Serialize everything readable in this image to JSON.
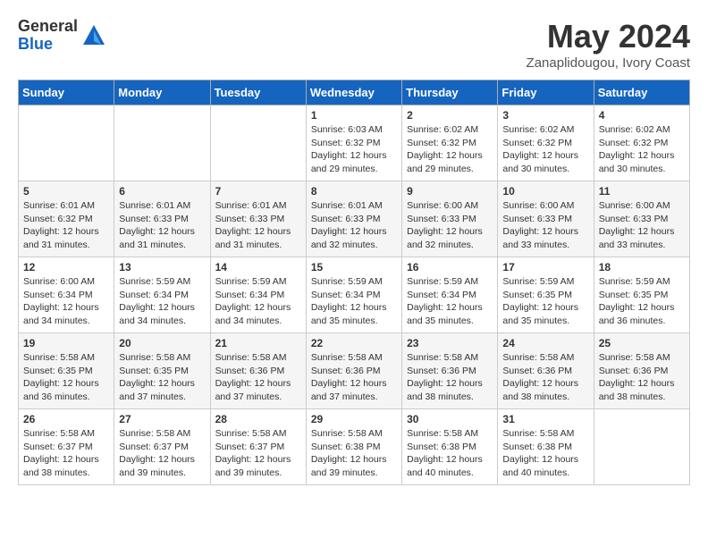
{
  "logo": {
    "general": "General",
    "blue": "Blue"
  },
  "title": "May 2024",
  "location": "Zanaplidougou, Ivory Coast",
  "weekdays": [
    "Sunday",
    "Monday",
    "Tuesday",
    "Wednesday",
    "Thursday",
    "Friday",
    "Saturday"
  ],
  "weeks": [
    [
      {
        "day": "",
        "sunrise": "",
        "sunset": "",
        "daylight": ""
      },
      {
        "day": "",
        "sunrise": "",
        "sunset": "",
        "daylight": ""
      },
      {
        "day": "",
        "sunrise": "",
        "sunset": "",
        "daylight": ""
      },
      {
        "day": "1",
        "sunrise": "Sunrise: 6:03 AM",
        "sunset": "Sunset: 6:32 PM",
        "daylight": "Daylight: 12 hours and 29 minutes."
      },
      {
        "day": "2",
        "sunrise": "Sunrise: 6:02 AM",
        "sunset": "Sunset: 6:32 PM",
        "daylight": "Daylight: 12 hours and 29 minutes."
      },
      {
        "day": "3",
        "sunrise": "Sunrise: 6:02 AM",
        "sunset": "Sunset: 6:32 PM",
        "daylight": "Daylight: 12 hours and 30 minutes."
      },
      {
        "day": "4",
        "sunrise": "Sunrise: 6:02 AM",
        "sunset": "Sunset: 6:32 PM",
        "daylight": "Daylight: 12 hours and 30 minutes."
      }
    ],
    [
      {
        "day": "5",
        "sunrise": "Sunrise: 6:01 AM",
        "sunset": "Sunset: 6:32 PM",
        "daylight": "Daylight: 12 hours and 31 minutes."
      },
      {
        "day": "6",
        "sunrise": "Sunrise: 6:01 AM",
        "sunset": "Sunset: 6:33 PM",
        "daylight": "Daylight: 12 hours and 31 minutes."
      },
      {
        "day": "7",
        "sunrise": "Sunrise: 6:01 AM",
        "sunset": "Sunset: 6:33 PM",
        "daylight": "Daylight: 12 hours and 31 minutes."
      },
      {
        "day": "8",
        "sunrise": "Sunrise: 6:01 AM",
        "sunset": "Sunset: 6:33 PM",
        "daylight": "Daylight: 12 hours and 32 minutes."
      },
      {
        "day": "9",
        "sunrise": "Sunrise: 6:00 AM",
        "sunset": "Sunset: 6:33 PM",
        "daylight": "Daylight: 12 hours and 32 minutes."
      },
      {
        "day": "10",
        "sunrise": "Sunrise: 6:00 AM",
        "sunset": "Sunset: 6:33 PM",
        "daylight": "Daylight: 12 hours and 33 minutes."
      },
      {
        "day": "11",
        "sunrise": "Sunrise: 6:00 AM",
        "sunset": "Sunset: 6:33 PM",
        "daylight": "Daylight: 12 hours and 33 minutes."
      }
    ],
    [
      {
        "day": "12",
        "sunrise": "Sunrise: 6:00 AM",
        "sunset": "Sunset: 6:34 PM",
        "daylight": "Daylight: 12 hours and 34 minutes."
      },
      {
        "day": "13",
        "sunrise": "Sunrise: 5:59 AM",
        "sunset": "Sunset: 6:34 PM",
        "daylight": "Daylight: 12 hours and 34 minutes."
      },
      {
        "day": "14",
        "sunrise": "Sunrise: 5:59 AM",
        "sunset": "Sunset: 6:34 PM",
        "daylight": "Daylight: 12 hours and 34 minutes."
      },
      {
        "day": "15",
        "sunrise": "Sunrise: 5:59 AM",
        "sunset": "Sunset: 6:34 PM",
        "daylight": "Daylight: 12 hours and 35 minutes."
      },
      {
        "day": "16",
        "sunrise": "Sunrise: 5:59 AM",
        "sunset": "Sunset: 6:34 PM",
        "daylight": "Daylight: 12 hours and 35 minutes."
      },
      {
        "day": "17",
        "sunrise": "Sunrise: 5:59 AM",
        "sunset": "Sunset: 6:35 PM",
        "daylight": "Daylight: 12 hours and 35 minutes."
      },
      {
        "day": "18",
        "sunrise": "Sunrise: 5:59 AM",
        "sunset": "Sunset: 6:35 PM",
        "daylight": "Daylight: 12 hours and 36 minutes."
      }
    ],
    [
      {
        "day": "19",
        "sunrise": "Sunrise: 5:58 AM",
        "sunset": "Sunset: 6:35 PM",
        "daylight": "Daylight: 12 hours and 36 minutes."
      },
      {
        "day": "20",
        "sunrise": "Sunrise: 5:58 AM",
        "sunset": "Sunset: 6:35 PM",
        "daylight": "Daylight: 12 hours and 37 minutes."
      },
      {
        "day": "21",
        "sunrise": "Sunrise: 5:58 AM",
        "sunset": "Sunset: 6:36 PM",
        "daylight": "Daylight: 12 hours and 37 minutes."
      },
      {
        "day": "22",
        "sunrise": "Sunrise: 5:58 AM",
        "sunset": "Sunset: 6:36 PM",
        "daylight": "Daylight: 12 hours and 37 minutes."
      },
      {
        "day": "23",
        "sunrise": "Sunrise: 5:58 AM",
        "sunset": "Sunset: 6:36 PM",
        "daylight": "Daylight: 12 hours and 38 minutes."
      },
      {
        "day": "24",
        "sunrise": "Sunrise: 5:58 AM",
        "sunset": "Sunset: 6:36 PM",
        "daylight": "Daylight: 12 hours and 38 minutes."
      },
      {
        "day": "25",
        "sunrise": "Sunrise: 5:58 AM",
        "sunset": "Sunset: 6:36 PM",
        "daylight": "Daylight: 12 hours and 38 minutes."
      }
    ],
    [
      {
        "day": "26",
        "sunrise": "Sunrise: 5:58 AM",
        "sunset": "Sunset: 6:37 PM",
        "daylight": "Daylight: 12 hours and 38 minutes."
      },
      {
        "day": "27",
        "sunrise": "Sunrise: 5:58 AM",
        "sunset": "Sunset: 6:37 PM",
        "daylight": "Daylight: 12 hours and 39 minutes."
      },
      {
        "day": "28",
        "sunrise": "Sunrise: 5:58 AM",
        "sunset": "Sunset: 6:37 PM",
        "daylight": "Daylight: 12 hours and 39 minutes."
      },
      {
        "day": "29",
        "sunrise": "Sunrise: 5:58 AM",
        "sunset": "Sunset: 6:38 PM",
        "daylight": "Daylight: 12 hours and 39 minutes."
      },
      {
        "day": "30",
        "sunrise": "Sunrise: 5:58 AM",
        "sunset": "Sunset: 6:38 PM",
        "daylight": "Daylight: 12 hours and 40 minutes."
      },
      {
        "day": "31",
        "sunrise": "Sunrise: 5:58 AM",
        "sunset": "Sunset: 6:38 PM",
        "daylight": "Daylight: 12 hours and 40 minutes."
      },
      {
        "day": "",
        "sunrise": "",
        "sunset": "",
        "daylight": ""
      }
    ]
  ]
}
